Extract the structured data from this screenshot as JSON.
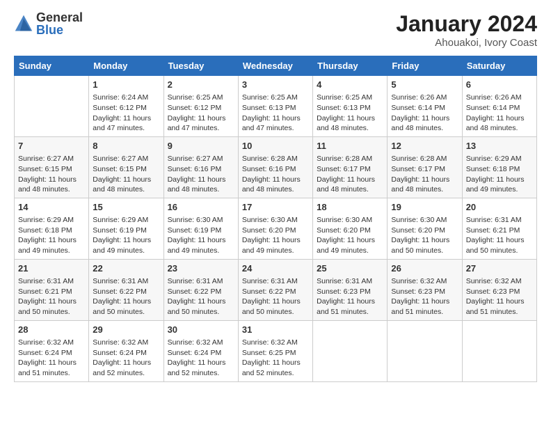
{
  "logo": {
    "general": "General",
    "blue": "Blue"
  },
  "title": "January 2024",
  "subtitle": "Ahouakoi, Ivory Coast",
  "days_of_week": [
    "Sunday",
    "Monday",
    "Tuesday",
    "Wednesday",
    "Thursday",
    "Friday",
    "Saturday"
  ],
  "weeks": [
    [
      {
        "day": "",
        "content": ""
      },
      {
        "day": "1",
        "content": "Sunrise: 6:24 AM\nSunset: 6:12 PM\nDaylight: 11 hours and 47 minutes."
      },
      {
        "day": "2",
        "content": "Sunrise: 6:25 AM\nSunset: 6:12 PM\nDaylight: 11 hours and 47 minutes."
      },
      {
        "day": "3",
        "content": "Sunrise: 6:25 AM\nSunset: 6:13 PM\nDaylight: 11 hours and 47 minutes."
      },
      {
        "day": "4",
        "content": "Sunrise: 6:25 AM\nSunset: 6:13 PM\nDaylight: 11 hours and 48 minutes."
      },
      {
        "day": "5",
        "content": "Sunrise: 6:26 AM\nSunset: 6:14 PM\nDaylight: 11 hours and 48 minutes."
      },
      {
        "day": "6",
        "content": "Sunrise: 6:26 AM\nSunset: 6:14 PM\nDaylight: 11 hours and 48 minutes."
      }
    ],
    [
      {
        "day": "7",
        "content": "Sunrise: 6:27 AM\nSunset: 6:15 PM\nDaylight: 11 hours and 48 minutes."
      },
      {
        "day": "8",
        "content": "Sunrise: 6:27 AM\nSunset: 6:15 PM\nDaylight: 11 hours and 48 minutes."
      },
      {
        "day": "9",
        "content": "Sunrise: 6:27 AM\nSunset: 6:16 PM\nDaylight: 11 hours and 48 minutes."
      },
      {
        "day": "10",
        "content": "Sunrise: 6:28 AM\nSunset: 6:16 PM\nDaylight: 11 hours and 48 minutes."
      },
      {
        "day": "11",
        "content": "Sunrise: 6:28 AM\nSunset: 6:17 PM\nDaylight: 11 hours and 48 minutes."
      },
      {
        "day": "12",
        "content": "Sunrise: 6:28 AM\nSunset: 6:17 PM\nDaylight: 11 hours and 48 minutes."
      },
      {
        "day": "13",
        "content": "Sunrise: 6:29 AM\nSunset: 6:18 PM\nDaylight: 11 hours and 49 minutes."
      }
    ],
    [
      {
        "day": "14",
        "content": "Sunrise: 6:29 AM\nSunset: 6:18 PM\nDaylight: 11 hours and 49 minutes."
      },
      {
        "day": "15",
        "content": "Sunrise: 6:29 AM\nSunset: 6:19 PM\nDaylight: 11 hours and 49 minutes."
      },
      {
        "day": "16",
        "content": "Sunrise: 6:30 AM\nSunset: 6:19 PM\nDaylight: 11 hours and 49 minutes."
      },
      {
        "day": "17",
        "content": "Sunrise: 6:30 AM\nSunset: 6:20 PM\nDaylight: 11 hours and 49 minutes."
      },
      {
        "day": "18",
        "content": "Sunrise: 6:30 AM\nSunset: 6:20 PM\nDaylight: 11 hours and 49 minutes."
      },
      {
        "day": "19",
        "content": "Sunrise: 6:30 AM\nSunset: 6:20 PM\nDaylight: 11 hours and 50 minutes."
      },
      {
        "day": "20",
        "content": "Sunrise: 6:31 AM\nSunset: 6:21 PM\nDaylight: 11 hours and 50 minutes."
      }
    ],
    [
      {
        "day": "21",
        "content": "Sunrise: 6:31 AM\nSunset: 6:21 PM\nDaylight: 11 hours and 50 minutes."
      },
      {
        "day": "22",
        "content": "Sunrise: 6:31 AM\nSunset: 6:22 PM\nDaylight: 11 hours and 50 minutes."
      },
      {
        "day": "23",
        "content": "Sunrise: 6:31 AM\nSunset: 6:22 PM\nDaylight: 11 hours and 50 minutes."
      },
      {
        "day": "24",
        "content": "Sunrise: 6:31 AM\nSunset: 6:22 PM\nDaylight: 11 hours and 50 minutes."
      },
      {
        "day": "25",
        "content": "Sunrise: 6:31 AM\nSunset: 6:23 PM\nDaylight: 11 hours and 51 minutes."
      },
      {
        "day": "26",
        "content": "Sunrise: 6:32 AM\nSunset: 6:23 PM\nDaylight: 11 hours and 51 minutes."
      },
      {
        "day": "27",
        "content": "Sunrise: 6:32 AM\nSunset: 6:23 PM\nDaylight: 11 hours and 51 minutes."
      }
    ],
    [
      {
        "day": "28",
        "content": "Sunrise: 6:32 AM\nSunset: 6:24 PM\nDaylight: 11 hours and 51 minutes."
      },
      {
        "day": "29",
        "content": "Sunrise: 6:32 AM\nSunset: 6:24 PM\nDaylight: 11 hours and 52 minutes."
      },
      {
        "day": "30",
        "content": "Sunrise: 6:32 AM\nSunset: 6:24 PM\nDaylight: 11 hours and 52 minutes."
      },
      {
        "day": "31",
        "content": "Sunrise: 6:32 AM\nSunset: 6:25 PM\nDaylight: 11 hours and 52 minutes."
      },
      {
        "day": "",
        "content": ""
      },
      {
        "day": "",
        "content": ""
      },
      {
        "day": "",
        "content": ""
      }
    ]
  ]
}
